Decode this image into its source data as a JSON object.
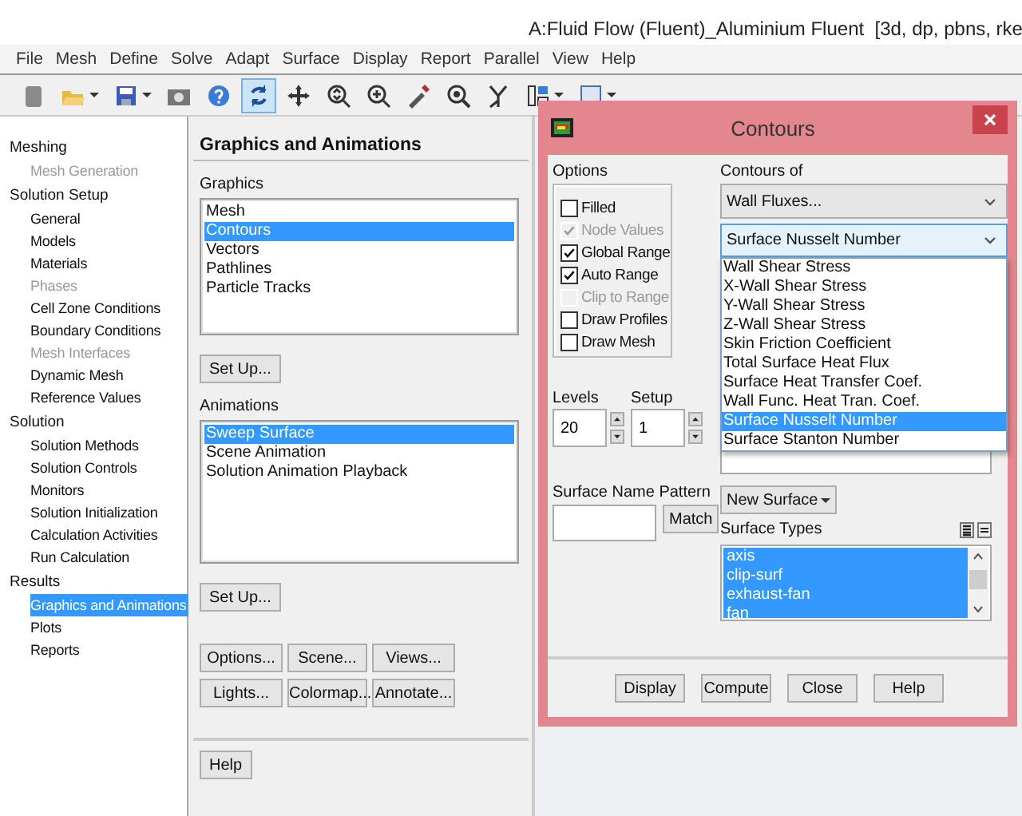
{
  "window": {
    "title": "A:Fluid Flow (Fluent)_Aluminium Fluent  [3d, dp, pbns, rke"
  },
  "menu": [
    "File",
    "Mesh",
    "Define",
    "Solve",
    "Adapt",
    "Surface",
    "Display",
    "Report",
    "Parallel",
    "View",
    "Help"
  ],
  "toolbar": {
    "tools": [
      {
        "kind": "grip",
        "selected": false,
        "menu": false
      },
      {
        "kind": "open",
        "selected": false,
        "menu": true
      },
      {
        "kind": "save",
        "selected": false,
        "menu": true
      },
      {
        "kind": "snapshot",
        "selected": false,
        "menu": false
      },
      {
        "kind": "help",
        "selected": false,
        "menu": false
      },
      {
        "kind": "rotate",
        "selected": true,
        "menu": false
      },
      {
        "kind": "pan",
        "selected": false,
        "menu": false
      },
      {
        "kind": "zoom",
        "selected": false,
        "menu": false
      },
      {
        "kind": "zoom-in",
        "selected": false,
        "menu": false
      },
      {
        "kind": "probe",
        "selected": false,
        "menu": false
      },
      {
        "kind": "fit",
        "selected": false,
        "menu": false
      },
      {
        "kind": "tree",
        "selected": false,
        "menu": false
      },
      {
        "kind": "layout",
        "selected": false,
        "menu": true
      },
      {
        "kind": "window",
        "selected": false,
        "menu": true
      }
    ]
  },
  "sidebar": {
    "groups": [
      {
        "label": "Meshing",
        "items": [
          {
            "label": "Mesh Generation",
            "disabled": true,
            "selected": false
          }
        ]
      },
      {
        "label": "Solution Setup",
        "items": [
          {
            "label": "General",
            "disabled": false,
            "selected": false
          },
          {
            "label": "Models",
            "disabled": false,
            "selected": false
          },
          {
            "label": "Materials",
            "disabled": false,
            "selected": false
          },
          {
            "label": "Phases",
            "disabled": true,
            "selected": false
          },
          {
            "label": "Cell Zone Conditions",
            "disabled": false,
            "selected": false
          },
          {
            "label": "Boundary Conditions",
            "disabled": false,
            "selected": false
          },
          {
            "label": "Mesh Interfaces",
            "disabled": true,
            "selected": false
          },
          {
            "label": "Dynamic Mesh",
            "disabled": false,
            "selected": false
          },
          {
            "label": "Reference Values",
            "disabled": false,
            "selected": false
          }
        ]
      },
      {
        "label": "Solution",
        "items": [
          {
            "label": "Solution Methods",
            "disabled": false,
            "selected": false
          },
          {
            "label": "Solution Controls",
            "disabled": false,
            "selected": false
          },
          {
            "label": "Monitors",
            "disabled": false,
            "selected": false
          },
          {
            "label": "Solution Initialization",
            "disabled": false,
            "selected": false
          },
          {
            "label": "Calculation Activities",
            "disabled": false,
            "selected": false
          },
          {
            "label": "Run Calculation",
            "disabled": false,
            "selected": false
          }
        ]
      },
      {
        "label": "Results",
        "items": [
          {
            "label": "Graphics and Animations",
            "disabled": false,
            "selected": true
          },
          {
            "label": "Plots",
            "disabled": false,
            "selected": false
          },
          {
            "label": "Reports",
            "disabled": false,
            "selected": false
          }
        ]
      }
    ]
  },
  "panel": {
    "title": "Graphics and Animations",
    "graphics": {
      "label": "Graphics",
      "items": [
        {
          "label": "Mesh",
          "selected": false
        },
        {
          "label": "Contours",
          "selected": true
        },
        {
          "label": "Vectors",
          "selected": false
        },
        {
          "label": "Pathlines",
          "selected": false
        },
        {
          "label": "Particle Tracks",
          "selected": false
        }
      ],
      "button": "Set Up..."
    },
    "animations": {
      "label": "Animations",
      "items": [
        {
          "label": "Sweep Surface",
          "selected": true
        },
        {
          "label": "Scene Animation",
          "selected": false
        },
        {
          "label": "Solution Animation Playback",
          "selected": false
        }
      ],
      "button": "Set Up..."
    },
    "buttons": [
      "Options...",
      "Scene...",
      "Views...",
      "Lights...",
      "Colormap...",
      "Annotate..."
    ],
    "help": "Help"
  },
  "dialog": {
    "title": "Contours",
    "options": {
      "label": "Options",
      "items": [
        {
          "label": "Filled",
          "checked": false,
          "disabled": false
        },
        {
          "label": "Node Values",
          "checked": true,
          "disabled": true
        },
        {
          "label": "Global Range",
          "checked": true,
          "disabled": false
        },
        {
          "label": "Auto Range",
          "checked": true,
          "disabled": false
        },
        {
          "label": "Clip to Range",
          "checked": false,
          "disabled": true
        },
        {
          "label": "Draw Profiles",
          "checked": false,
          "disabled": false
        },
        {
          "label": "Draw Mesh",
          "checked": false,
          "disabled": false
        }
      ]
    },
    "contours_of": {
      "label": "Contours of",
      "category": "Wall Fluxes...",
      "quantity": "Surface Nusselt Number",
      "expanded": true,
      "options": [
        {
          "label": "Wall Shear Stress",
          "selected": false
        },
        {
          "label": "X-Wall Shear Stress",
          "selected": false
        },
        {
          "label": "Y-Wall Shear Stress",
          "selected": false
        },
        {
          "label": "Z-Wall Shear Stress",
          "selected": false
        },
        {
          "label": "Skin Friction Coefficient",
          "selected": false
        },
        {
          "label": "Total Surface Heat Flux",
          "selected": false
        },
        {
          "label": "Surface Heat Transfer Coef.",
          "selected": false
        },
        {
          "label": "Wall Func. Heat Tran. Coef.",
          "selected": false
        },
        {
          "label": "Surface Nusselt Number",
          "selected": true
        },
        {
          "label": "Surface Stanton Number",
          "selected": false
        }
      ]
    },
    "levels": {
      "label": "Levels",
      "value": "20"
    },
    "setup": {
      "label": "Setup",
      "value": "1"
    },
    "surface_name_pattern": {
      "label": "Surface Name Pattern",
      "button": "Match"
    },
    "new_surface": "New Surface",
    "surface_types": {
      "label": "Surface Types",
      "items": [
        {
          "label": "axis",
          "selected": true
        },
        {
          "label": "clip-surf",
          "selected": true
        },
        {
          "label": "exhaust-fan",
          "selected": true
        },
        {
          "label": "fan",
          "selected": true
        }
      ]
    },
    "buttons": [
      "Display",
      "Compute",
      "Close",
      "Help"
    ]
  }
}
